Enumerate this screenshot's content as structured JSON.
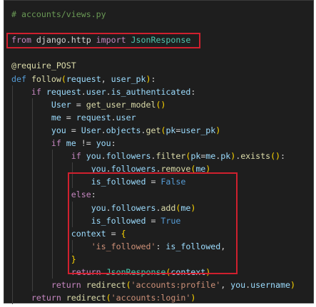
{
  "code": {
    "lines": [
      [
        {
          "t": "# accounts/views.py",
          "k": "comment"
        }
      ],
      [],
      [
        {
          "t": "from",
          "k": "control"
        },
        {
          "t": " ",
          "k": "plain"
        },
        {
          "t": "django.http",
          "k": "plain"
        },
        {
          "t": " ",
          "k": "plain"
        },
        {
          "t": "import",
          "k": "control"
        },
        {
          "t": " ",
          "k": "plain"
        },
        {
          "t": "JsonResponse",
          "k": "class"
        }
      ],
      [],
      [
        {
          "t": "@require_POST",
          "k": "func"
        }
      ],
      [
        {
          "t": "def",
          "k": "keyword"
        },
        {
          "t": " ",
          "k": "plain"
        },
        {
          "t": "follow",
          "k": "func"
        },
        {
          "t": "(",
          "k": "bracket1"
        },
        {
          "t": "request",
          "k": "var"
        },
        {
          "t": ", ",
          "k": "plain"
        },
        {
          "t": "user_pk",
          "k": "var"
        },
        {
          "t": ")",
          "k": "bracket1"
        },
        {
          "t": ":",
          "k": "plain"
        }
      ],
      [
        {
          "t": "    ",
          "k": "plain"
        },
        {
          "t": "if",
          "k": "control"
        },
        {
          "t": " ",
          "k": "plain"
        },
        {
          "t": "request",
          "k": "var"
        },
        {
          "t": ".",
          "k": "plain"
        },
        {
          "t": "user",
          "k": "var"
        },
        {
          "t": ".",
          "k": "plain"
        },
        {
          "t": "is_authenticated",
          "k": "var"
        },
        {
          "t": ":",
          "k": "plain"
        }
      ],
      [
        {
          "t": "        ",
          "k": "plain"
        },
        {
          "t": "User",
          "k": "var"
        },
        {
          "t": " = ",
          "k": "plain"
        },
        {
          "t": "get_user_model",
          "k": "func"
        },
        {
          "t": "()",
          "k": "bracket1"
        }
      ],
      [
        {
          "t": "        ",
          "k": "plain"
        },
        {
          "t": "me",
          "k": "var"
        },
        {
          "t": " = ",
          "k": "plain"
        },
        {
          "t": "request",
          "k": "var"
        },
        {
          "t": ".",
          "k": "plain"
        },
        {
          "t": "user",
          "k": "var"
        }
      ],
      [
        {
          "t": "        ",
          "k": "plain"
        },
        {
          "t": "you",
          "k": "var"
        },
        {
          "t": " = ",
          "k": "plain"
        },
        {
          "t": "User",
          "k": "var"
        },
        {
          "t": ".",
          "k": "plain"
        },
        {
          "t": "objects",
          "k": "var"
        },
        {
          "t": ".",
          "k": "plain"
        },
        {
          "t": "get",
          "k": "func"
        },
        {
          "t": "(",
          "k": "bracket1"
        },
        {
          "t": "pk",
          "k": "var"
        },
        {
          "t": "=",
          "k": "plain"
        },
        {
          "t": "user_pk",
          "k": "var"
        },
        {
          "t": ")",
          "k": "bracket1"
        }
      ],
      [
        {
          "t": "        ",
          "k": "plain"
        },
        {
          "t": "if",
          "k": "control"
        },
        {
          "t": " ",
          "k": "plain"
        },
        {
          "t": "me",
          "k": "var"
        },
        {
          "t": " != ",
          "k": "plain"
        },
        {
          "t": "you",
          "k": "var"
        },
        {
          "t": ":",
          "k": "plain"
        }
      ],
      [
        {
          "t": "            ",
          "k": "plain"
        },
        {
          "t": "if",
          "k": "control"
        },
        {
          "t": " ",
          "k": "plain"
        },
        {
          "t": "you",
          "k": "var"
        },
        {
          "t": ".",
          "k": "plain"
        },
        {
          "t": "followers",
          "k": "var"
        },
        {
          "t": ".",
          "k": "plain"
        },
        {
          "t": "filter",
          "k": "func"
        },
        {
          "t": "(",
          "k": "bracket1"
        },
        {
          "t": "pk",
          "k": "var"
        },
        {
          "t": "=",
          "k": "plain"
        },
        {
          "t": "me",
          "k": "var"
        },
        {
          "t": ".",
          "k": "plain"
        },
        {
          "t": "pk",
          "k": "var"
        },
        {
          "t": ")",
          "k": "bracket1"
        },
        {
          "t": ".",
          "k": "plain"
        },
        {
          "t": "exists",
          "k": "func"
        },
        {
          "t": "()",
          "k": "bracket1"
        },
        {
          "t": ":",
          "k": "plain"
        }
      ],
      [
        {
          "t": "                ",
          "k": "plain"
        },
        {
          "t": "you",
          "k": "var"
        },
        {
          "t": ".",
          "k": "plain"
        },
        {
          "t": "followers",
          "k": "var"
        },
        {
          "t": ".",
          "k": "plain"
        },
        {
          "t": "remove",
          "k": "func"
        },
        {
          "t": "(",
          "k": "bracket1"
        },
        {
          "t": "me",
          "k": "var"
        },
        {
          "t": ")",
          "k": "bracket1"
        }
      ],
      [
        {
          "t": "                ",
          "k": "plain"
        },
        {
          "t": "is_followed",
          "k": "var"
        },
        {
          "t": " = ",
          "k": "plain"
        },
        {
          "t": "False",
          "k": "keyword"
        }
      ],
      [
        {
          "t": "            ",
          "k": "plain"
        },
        {
          "t": "else",
          "k": "control"
        },
        {
          "t": ":",
          "k": "plain"
        }
      ],
      [
        {
          "t": "                ",
          "k": "plain"
        },
        {
          "t": "you",
          "k": "var"
        },
        {
          "t": ".",
          "k": "plain"
        },
        {
          "t": "followers",
          "k": "var"
        },
        {
          "t": ".",
          "k": "plain"
        },
        {
          "t": "add",
          "k": "func"
        },
        {
          "t": "(",
          "k": "bracket1"
        },
        {
          "t": "me",
          "k": "var"
        },
        {
          "t": ")",
          "k": "bracket1"
        }
      ],
      [
        {
          "t": "                ",
          "k": "plain"
        },
        {
          "t": "is_followed",
          "k": "var"
        },
        {
          "t": " = ",
          "k": "plain"
        },
        {
          "t": "True",
          "k": "keyword"
        }
      ],
      [
        {
          "t": "            ",
          "k": "plain"
        },
        {
          "t": "context",
          "k": "var"
        },
        {
          "t": " = ",
          "k": "plain"
        },
        {
          "t": "{",
          "k": "bracket1"
        }
      ],
      [
        {
          "t": "                ",
          "k": "plain"
        },
        {
          "t": "'is_followed'",
          "k": "string"
        },
        {
          "t": ": ",
          "k": "plain"
        },
        {
          "t": "is_followed",
          "k": "var"
        },
        {
          "t": ",",
          "k": "plain"
        }
      ],
      [
        {
          "t": "            ",
          "k": "plain"
        },
        {
          "t": "}",
          "k": "bracket1"
        }
      ],
      [
        {
          "t": "            ",
          "k": "plain"
        },
        {
          "t": "return",
          "k": "control"
        },
        {
          "t": " ",
          "k": "plain"
        },
        {
          "t": "JsonResponse",
          "k": "class"
        },
        {
          "t": "(",
          "k": "bracket1"
        },
        {
          "t": "context",
          "k": "var"
        },
        {
          "t": ")",
          "k": "bracket1"
        }
      ],
      [
        {
          "t": "        ",
          "k": "plain"
        },
        {
          "t": "return",
          "k": "control"
        },
        {
          "t": " ",
          "k": "plain"
        },
        {
          "t": "redirect",
          "k": "func"
        },
        {
          "t": "(",
          "k": "bracket1"
        },
        {
          "t": "'accounts:profile'",
          "k": "string"
        },
        {
          "t": ", ",
          "k": "plain"
        },
        {
          "t": "you",
          "k": "var"
        },
        {
          "t": ".",
          "k": "plain"
        },
        {
          "t": "username",
          "k": "var"
        },
        {
          "t": ")",
          "k": "bracket1"
        }
      ],
      [
        {
          "t": "    ",
          "k": "plain"
        },
        {
          "t": "return",
          "k": "control"
        },
        {
          "t": " ",
          "k": "plain"
        },
        {
          "t": "redirect",
          "k": "func"
        },
        {
          "t": "(",
          "k": "bracket1"
        },
        {
          "t": "'accounts:login'",
          "k": "string"
        },
        {
          "t": ")",
          "k": "bracket1"
        }
      ]
    ]
  },
  "highlights": [
    {
      "label": "import-highlight",
      "first_line": 2,
      "last_line": 2
    },
    {
      "label": "block-highlight",
      "first_line": 13,
      "last_line": 20
    }
  ],
  "colors": {
    "background": "#1e1e1e",
    "highlight_border": "#d0202e",
    "comment": "#6a9955",
    "keyword": "#569cd6",
    "control": "#c586c0",
    "function": "#dcdcaa",
    "class": "#4ec9b0",
    "variable": "#9cdcfe",
    "string": "#ce9178",
    "bracket": "#ffd700"
  }
}
